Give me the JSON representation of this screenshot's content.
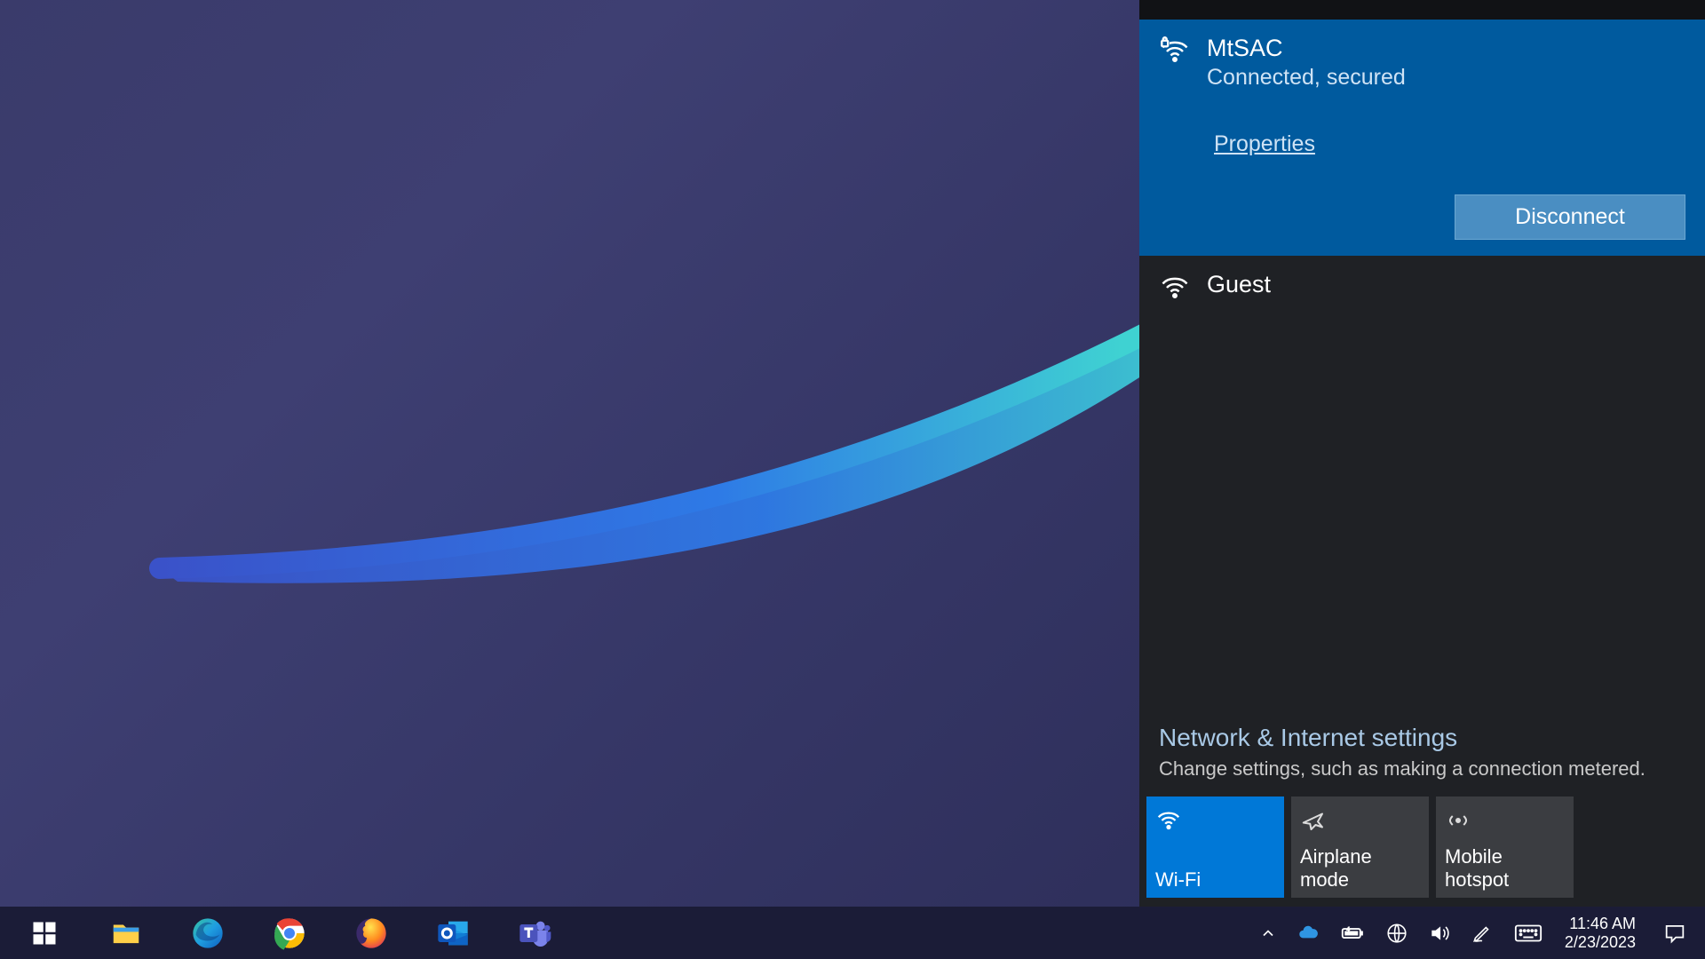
{
  "network_flyout": {
    "connected": {
      "ssid": "MtSAC",
      "status": "Connected, secured",
      "properties_link": "Properties",
      "disconnect_label": "Disconnect"
    },
    "available": [
      {
        "ssid": "Guest"
      }
    ],
    "settings": {
      "title": "Network & Internet settings",
      "subtitle": "Change settings, such as making a connection metered."
    },
    "quick_actions": {
      "wifi": "Wi-Fi",
      "airplane": "Airplane mode",
      "hotspot": "Mobile hotspot"
    }
  },
  "taskbar": {
    "time": "11:46 AM",
    "date": "2/23/2023"
  }
}
